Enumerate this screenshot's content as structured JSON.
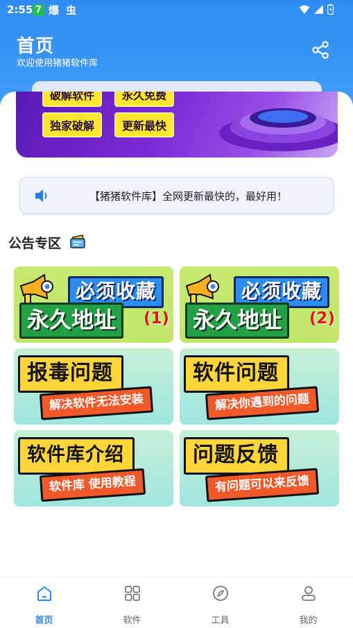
{
  "status_bar": {
    "time": "2:55",
    "badge": "7",
    "app1": "爆",
    "app2": "虫"
  },
  "header": {
    "title": "首页",
    "subtitle": "欢迎使用猪猪软件库",
    "share_icon": "share-icon"
  },
  "banner": {
    "top_left": "破解软件",
    "top_right": "永久免费",
    "bottom_left": "独家破解",
    "bottom_right": "更新最快"
  },
  "notice": {
    "icon": "speaker-icon",
    "text": "【猪猪软件库】全网更新最快的，最好用！"
  },
  "section": {
    "title": "公告专区"
  },
  "cards": [
    {
      "top": "必须收藏",
      "main": "永久地址",
      "num": "(1)"
    },
    {
      "top": "必须收藏",
      "main": "永久地址",
      "num": "(2)"
    },
    {
      "main": "报毒问题",
      "sub": "解决软件无法安装"
    },
    {
      "main": "软件问题",
      "sub": "解决你遇到的问题"
    },
    {
      "main": "软件库介绍",
      "sub": "软件库 使用教程"
    },
    {
      "main": "问题反馈",
      "sub": "有问题可以来反馈"
    }
  ],
  "nav": {
    "items": [
      {
        "label": "首页",
        "icon": "home-icon",
        "active": true
      },
      {
        "label": "软件",
        "icon": "grid-icon",
        "active": false
      },
      {
        "label": "工具",
        "icon": "compass-icon",
        "active": false
      },
      {
        "label": "我的",
        "icon": "user-icon",
        "active": false
      }
    ]
  },
  "colors": {
    "primary": "#2f8cf2",
    "nav_active": "#2a88ee"
  }
}
